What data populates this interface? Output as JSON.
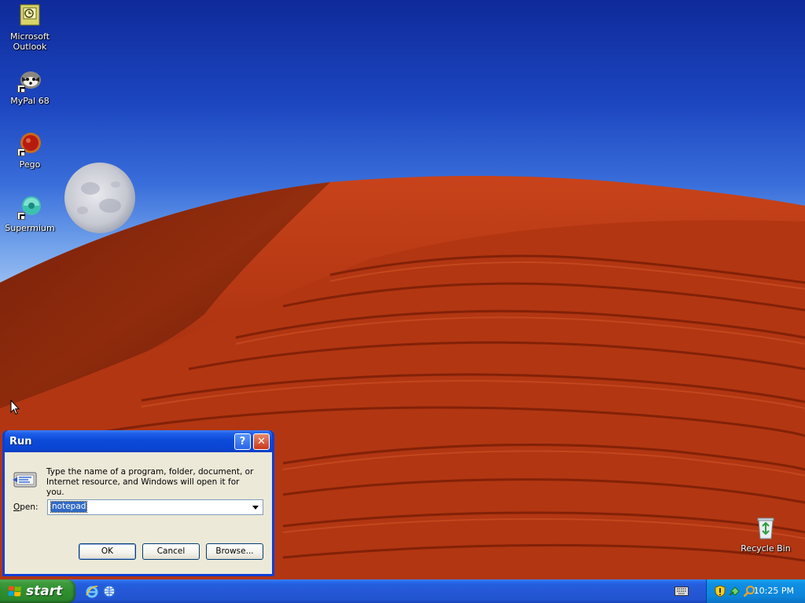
{
  "desktop": {
    "icons": [
      {
        "label_line1": "Microsoft",
        "label_line2": "Outlook",
        "icon": "outlook-icon"
      },
      {
        "label_line1": "MyPal 68",
        "label_line2": "",
        "icon": "mypal-icon"
      },
      {
        "label_line1": "Pego",
        "label_line2": "",
        "icon": "pego-icon"
      },
      {
        "label_line1": "Supermium",
        "label_line2": "",
        "icon": "supermium-icon"
      },
      {
        "label_line1": "Recycle Bin",
        "label_line2": "",
        "icon": "recycle-bin-icon"
      }
    ]
  },
  "run_dialog": {
    "title": "Run",
    "help_glyph": "?",
    "close_glyph": "✕",
    "description": "Type the name of a program, folder, document, or Internet resource, and Windows will open it for you.",
    "open_label_prefix": "",
    "open_label_underlined": "O",
    "open_label_rest": "pen:",
    "open_value": "notepad",
    "ok_label": "OK",
    "cancel_label": "Cancel",
    "browse_label": "Browse..."
  },
  "taskbar": {
    "start_label": "start",
    "quick_launch": [
      "internet-explorer-icon",
      "browser-icon"
    ],
    "tray_icons": [
      "security-shield-icon",
      "network-icon",
      "search-icon"
    ],
    "clock": "10:25 PM"
  },
  "colors": {
    "taskbar_blue": "#245fdf",
    "start_green": "#2f8f2f",
    "tray_blue": "#0f8fe3",
    "dialog_face": "#ece9d8",
    "selection": "#316ac5"
  }
}
